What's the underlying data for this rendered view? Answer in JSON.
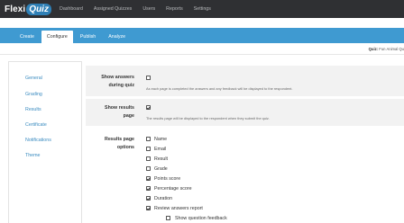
{
  "app": {
    "logo_flexi": "Flexi",
    "logo_quiz": "Quiz"
  },
  "nav": {
    "items": [
      "Dashboard",
      "Assigned Quizzes",
      "Users",
      "Reports",
      "Settings"
    ]
  },
  "tabs": {
    "items": [
      "Create",
      "Configure",
      "Publish",
      "Analyze"
    ],
    "active": "Configure"
  },
  "quiz": {
    "label": "Quiz:",
    "name": "Fun Animal Qu"
  },
  "sidebar": {
    "items": [
      "General",
      "Grading",
      "Results",
      "Certificate",
      "Notifications",
      "Theme"
    ],
    "active": "Results"
  },
  "settings": {
    "show_answers": {
      "label_line1": "Show answers",
      "label_line2": "during quiz",
      "checked": false,
      "description": "As each page is completed the answers and any feedback will be displayed to the respondent."
    },
    "show_results": {
      "label_line1": "Show results",
      "label_line2": "page",
      "checked": true,
      "description": "The results page will be displayed to the respondent when they submit the quiz."
    },
    "results_options": {
      "label_line1": "Results page",
      "label_line2": "options",
      "options": [
        {
          "label": "Name",
          "checked": false
        },
        {
          "label": "Email",
          "checked": false
        },
        {
          "label": "Result",
          "checked": false
        },
        {
          "label": "Grade",
          "checked": false
        },
        {
          "label": "Points score",
          "checked": true
        },
        {
          "label": "Percentage score",
          "checked": true
        },
        {
          "label": "Duration",
          "checked": true
        },
        {
          "label": "Review answers report",
          "checked": true
        },
        {
          "label": "Show question feedback",
          "checked": false
        }
      ]
    }
  },
  "colors": {
    "topbar": "#2f3033",
    "subbar": "#3f9ad1",
    "link": "#3a8bc0",
    "logo_badge": "#2f80b6"
  }
}
